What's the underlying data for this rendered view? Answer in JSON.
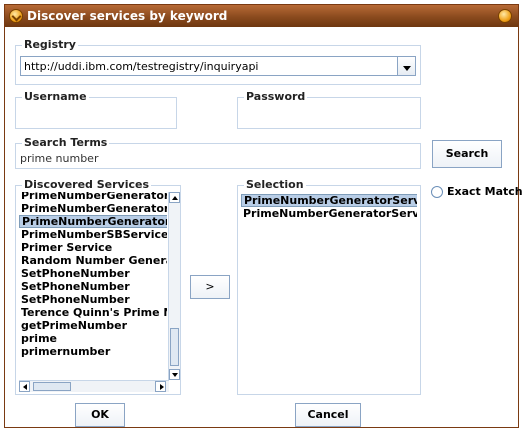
{
  "window": {
    "title": "Discover services by keyword"
  },
  "registry": {
    "label": "Registry",
    "value": "http://uddi.ibm.com/testregistry/inquiryapi"
  },
  "username": {
    "label": "Username",
    "value": ""
  },
  "password": {
    "label": "Password",
    "value": ""
  },
  "search": {
    "label": "Search Terms",
    "value": "prime number",
    "button": "Search"
  },
  "exact_match": {
    "label": "Exact Match",
    "checked": false
  },
  "discovered": {
    "label": "Discovered Services",
    "items": [
      {
        "text": "PrimeNumberGeneratorSer",
        "selected": false
      },
      {
        "text": "PrimeNumberGeneratorSer",
        "selected": false
      },
      {
        "text": "PrimeNumberGeneratorSer",
        "selected": true
      },
      {
        "text": "PrimeNumberSBService",
        "selected": false
      },
      {
        "text": "Primer Service",
        "selected": false
      },
      {
        "text": "Random Number Generato",
        "selected": false
      },
      {
        "text": "SetPhoneNumber",
        "selected": false
      },
      {
        "text": "SetPhoneNumber",
        "selected": false
      },
      {
        "text": "SetPhoneNumber",
        "selected": false
      },
      {
        "text": "Terence Quinn's Prime Nu",
        "selected": false
      },
      {
        "text": "getPrimeNumber",
        "selected": false
      },
      {
        "text": "prime",
        "selected": false
      },
      {
        "text": "primernumber",
        "selected": false
      }
    ]
  },
  "move_button": {
    "label": ">"
  },
  "selection": {
    "label": "Selection",
    "items": [
      {
        "text": "PrimeNumberGeneratorService",
        "selected": true
      },
      {
        "text": "PrimeNumberGeneratorService",
        "selected": false
      }
    ]
  },
  "footer": {
    "ok": "OK",
    "cancel": "Cancel"
  }
}
